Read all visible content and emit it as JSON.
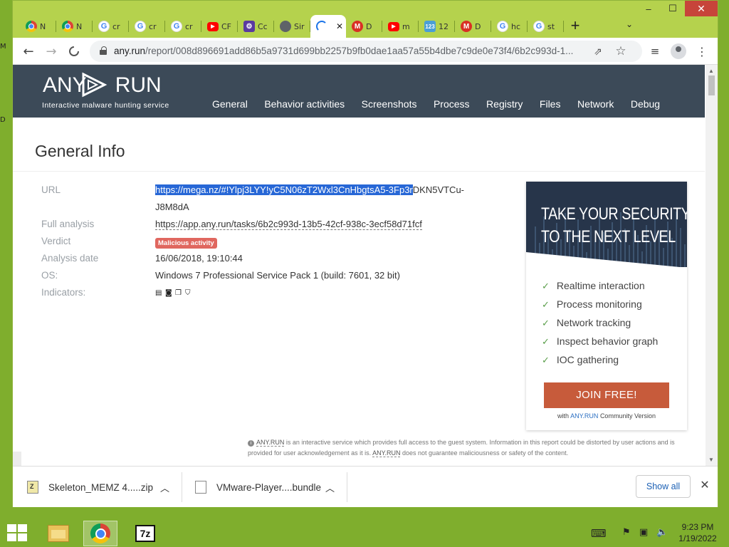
{
  "desktop": {
    "edge_glyphs": [
      "M",
      "D"
    ]
  },
  "browser": {
    "tabs": [
      {
        "icon": "chrome",
        "title": "N"
      },
      {
        "icon": "chrome",
        "title": "N"
      },
      {
        "icon": "google",
        "title": "cr"
      },
      {
        "icon": "google",
        "title": "cr"
      },
      {
        "icon": "google",
        "title": "cr"
      },
      {
        "icon": "youtube",
        "title": "CF"
      },
      {
        "icon": "cc",
        "title": "Cc"
      },
      {
        "icon": "globe",
        "title": "Sir"
      },
      {
        "icon": "loading",
        "title": "",
        "active": true
      },
      {
        "icon": "gmail",
        "title": "D"
      },
      {
        "icon": "youtube",
        "title": "m"
      },
      {
        "icon": "numbers",
        "title": "12"
      },
      {
        "icon": "gmail",
        "title": "D"
      },
      {
        "icon": "google",
        "title": "hc"
      },
      {
        "icon": "google",
        "title": "st"
      }
    ],
    "new_tab": "+",
    "tab_menu": "⌄",
    "window_controls": {
      "minimize": "–",
      "maximize": "☐",
      "close": "✕"
    },
    "address": {
      "host": "any.run",
      "path": "/report/008d896691add86b5a9731d699bb2257b9fb0dae1aa57a55b4dbe7c9de0e73f4/6b2c993d-1..."
    }
  },
  "site": {
    "logo": "ANY RUN",
    "logo_left": "ANY",
    "logo_right": "RUN",
    "tagline": "Interactive malware hunting service",
    "nav": [
      "General",
      "Behavior activities",
      "Screenshots",
      "Process",
      "Registry",
      "Files",
      "Network",
      "Debug"
    ]
  },
  "general": {
    "title": "General Info",
    "url_label": "URL",
    "url_selected": "https://mega.nz/#!Ylpj3LYY!yC5N06zT2Wxl3CnHbgtsA5-3Fp3r",
    "url_rest": "DKN5VTCu-",
    "url_line2": "J8M8dA",
    "full_label": "Full analysis",
    "full_value": "https://app.any.run/tasks/6b2c993d-13b5-42cf-938c-3ecf58d71fcf",
    "verdict_label": "Verdict",
    "verdict_value": "Malicious activity",
    "date_label": "Analysis date",
    "date_value": "16/06/2018, 19:10:44",
    "os_label": "OS:",
    "os_value": "Windows 7 Professional Service Pack 1 (build: 7601, 32 bit)",
    "indicators_label": "Indicators:",
    "indicator_icons": [
      "exe-icon",
      "network-icon",
      "files-icon",
      "shield-icon"
    ]
  },
  "promo": {
    "heading_line1": "TAKE YOUR SECURITY",
    "heading_line2": "TO THE NEXT LEVEL",
    "features": [
      "Realtime interaction",
      "Process monitoring",
      "Network tracking",
      "Inspect behavior graph",
      "IOC gathering"
    ],
    "cta": "JOIN FREE!",
    "sub_prefix": "with",
    "sub_link": "ANY.RUN",
    "sub_suffix": "Community Version"
  },
  "disclaimer": {
    "brand": "ANY.RUN",
    "text1": "is an interactive service which provides full access to the guest system. Information in this report could be distorted by user actions and is provided for user acknowledgement as it is.",
    "brand2": "ANY.RUN",
    "text2": "does not guarantee maliciousness or safety of the content."
  },
  "downloads": {
    "items": [
      {
        "name": "Skeleton_MEMZ 4.....zip",
        "icon": "zip-icon"
      },
      {
        "name": "VMware-Player....bundle",
        "icon": "file-icon"
      }
    ],
    "show_all": "Show all"
  },
  "taskbar": {
    "apps": [
      "file-explorer",
      "chrome",
      "7zip"
    ],
    "sevenzip_label": "7z",
    "time": "9:23 PM",
    "date": "1/19/2022"
  }
}
